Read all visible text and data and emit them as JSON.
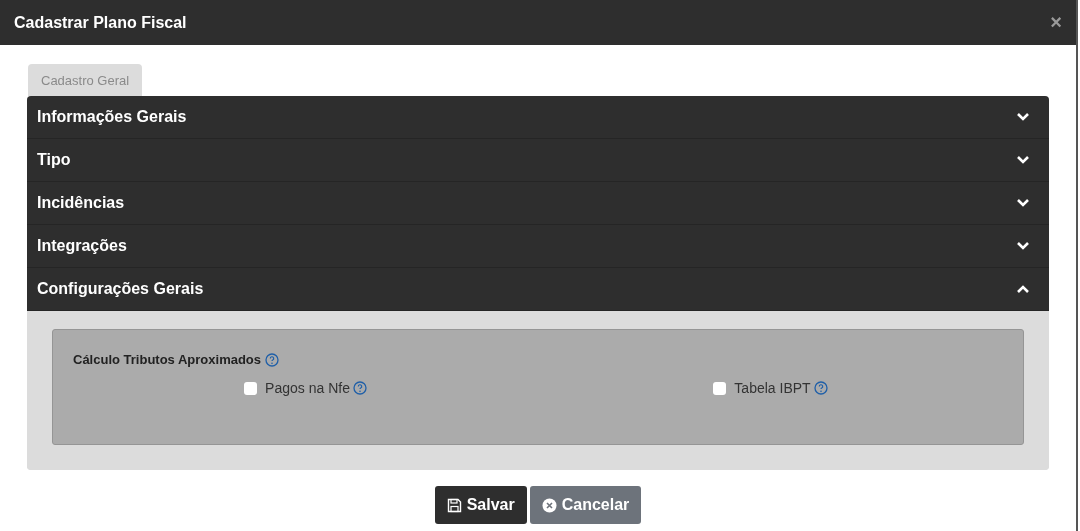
{
  "window": {
    "title": "Cadastrar Plano Fiscal",
    "close": "×"
  },
  "tabs": [
    {
      "label": "Cadastro Geral",
      "selected": false
    }
  ],
  "sections": [
    {
      "title": "Informações Gerais",
      "expanded": false
    },
    {
      "title": "Tipo",
      "expanded": false
    },
    {
      "title": "Incidências",
      "expanded": false
    },
    {
      "title": "Integrações",
      "expanded": false
    },
    {
      "title": "Configurações Gerais",
      "expanded": true,
      "group": {
        "title": "Cálculo Tributos Aproximados",
        "options": [
          {
            "label": "Pagos na Nfe",
            "checked": false
          },
          {
            "label": "Tabela IBPT",
            "checked": false
          }
        ]
      }
    }
  ],
  "buttons": [
    {
      "label": "Salvar",
      "kind": "save"
    },
    {
      "label": "Cancelar",
      "kind": "cancel"
    }
  ]
}
